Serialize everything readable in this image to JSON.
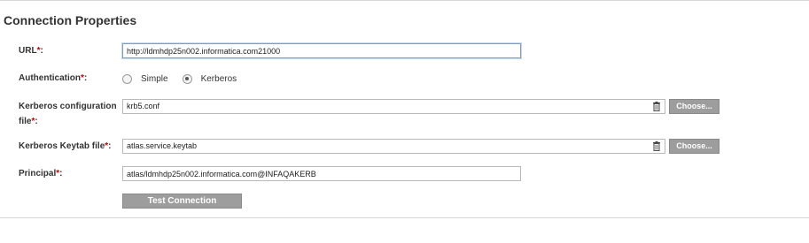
{
  "section": {
    "title": "Connection Properties"
  },
  "fields": {
    "url": {
      "label": "URL",
      "required_mark": "*",
      "colon": ":",
      "value": "http://ldmhdp25n002.informatica.com21000"
    },
    "authentication": {
      "label": "Authentication",
      "required_mark": "*",
      "colon": ":",
      "options": [
        {
          "label": "Simple",
          "selected": false
        },
        {
          "label": "Kerberos",
          "selected": true
        }
      ]
    },
    "krb_config": {
      "label_line1": "Kerberos configuration",
      "label_line2": "file",
      "required_mark": "*",
      "colon": ":",
      "value": "krb5.conf",
      "choose_label": "Choose..."
    },
    "keytab": {
      "label": "Kerberos Keytab file",
      "required_mark": "*",
      "colon": ":",
      "value": "atlas.service.keytab",
      "choose_label": "Choose..."
    },
    "principal": {
      "label": "Principal",
      "required_mark": "*",
      "colon": ":",
      "value": "atlas/ldmhdp25n002.informatica.com@INFAQAKERB"
    }
  },
  "actions": {
    "test_connection": "Test Connection"
  },
  "icons": {
    "delete": "trash-icon"
  }
}
